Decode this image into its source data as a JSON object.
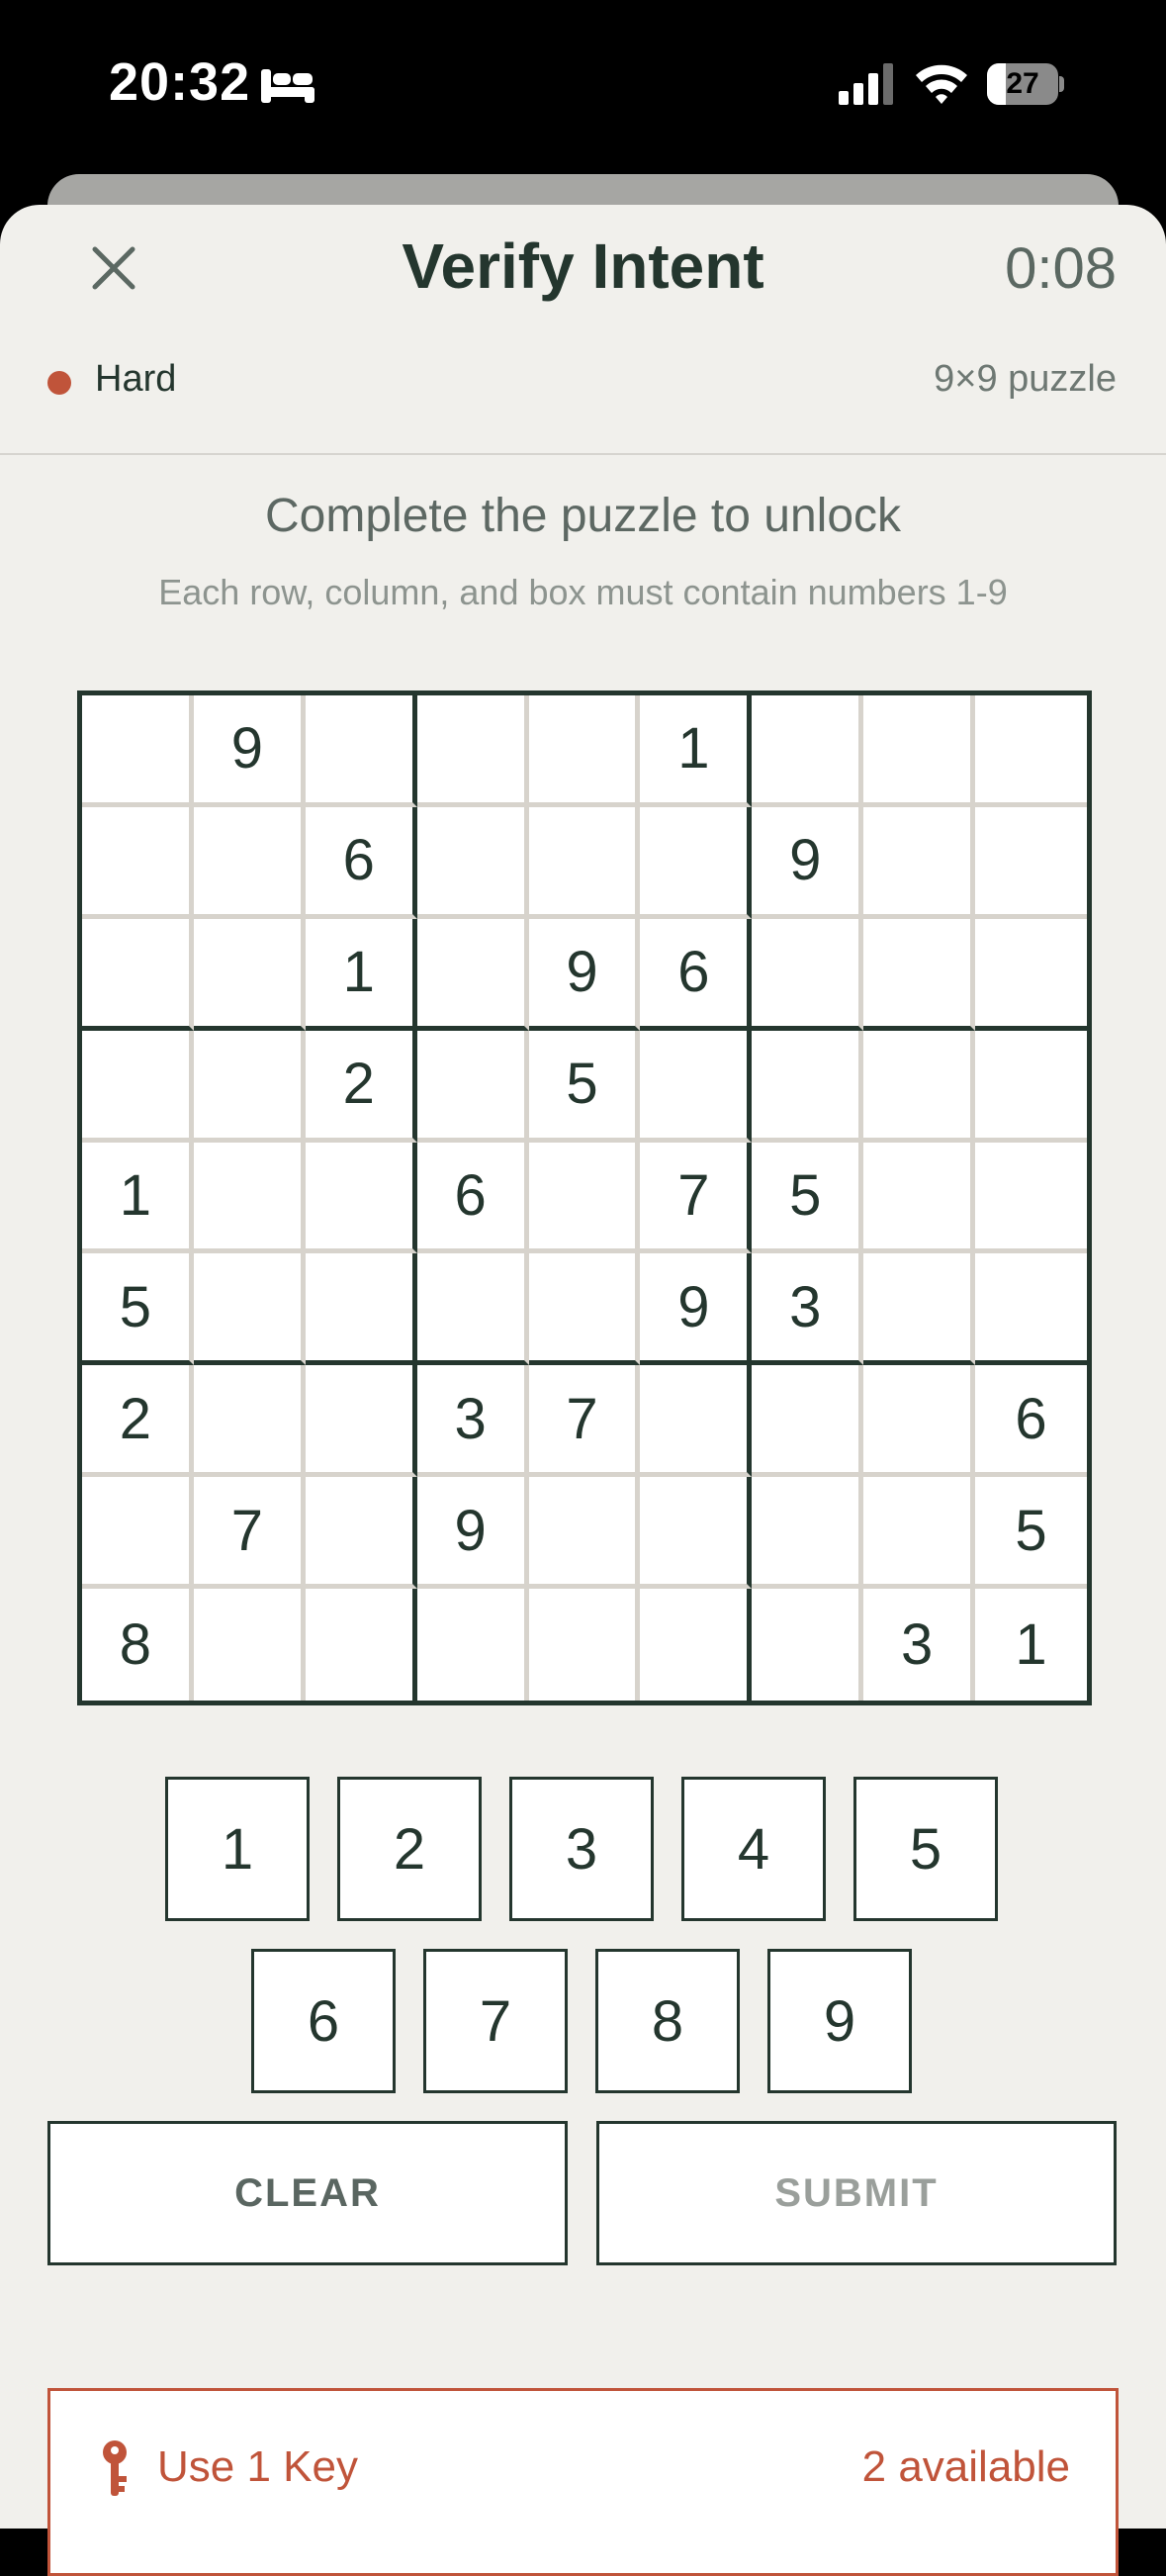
{
  "status_bar": {
    "time": "20:32",
    "battery": "27",
    "battery_level": 0.27,
    "icons": [
      "sleep-focus-icon",
      "cellular-signal-icon",
      "wifi-icon",
      "battery-icon"
    ]
  },
  "header": {
    "close_icon": "close-icon",
    "title": "Verify Intent",
    "timer": "0:08"
  },
  "meta": {
    "difficulty": "Hard",
    "difficulty_color": "#c0543a",
    "size": "9×9 puzzle"
  },
  "instructions": {
    "heading": "Complete the puzzle to unlock",
    "subheading": "Each row, column, and box must contain numbers 1-9"
  },
  "grid": [
    [
      "",
      "9",
      "",
      "",
      "",
      "1",
      "",
      "",
      ""
    ],
    [
      "",
      "",
      "6",
      "",
      "",
      "",
      "9",
      "",
      ""
    ],
    [
      "",
      "",
      "1",
      "",
      "9",
      "6",
      "",
      "",
      ""
    ],
    [
      "",
      "",
      "2",
      "",
      "5",
      "",
      "",
      "",
      ""
    ],
    [
      "1",
      "",
      "",
      "6",
      "",
      "7",
      "5",
      "",
      ""
    ],
    [
      "5",
      "",
      "",
      "",
      "",
      "9",
      "3",
      "",
      ""
    ],
    [
      "2",
      "",
      "",
      "3",
      "7",
      "",
      "",
      "",
      "6"
    ],
    [
      "",
      "7",
      "",
      "9",
      "",
      "",
      "",
      "",
      "5"
    ],
    [
      "8",
      "",
      "",
      "",
      "",
      "",
      "",
      "3",
      "1"
    ]
  ],
  "keypad": [
    "1",
    "2",
    "3",
    "4",
    "5",
    "6",
    "7",
    "8",
    "9"
  ],
  "actions": {
    "clear": "CLEAR",
    "submit": "SUBMIT"
  },
  "key_bar": {
    "icon": "key-icon",
    "label": "Use 1 Key",
    "available": "2 available",
    "accent": "#c0543a"
  },
  "colors": {
    "background": "#f1f0ec",
    "ink": "#24362e",
    "accent": "#c0543a"
  }
}
